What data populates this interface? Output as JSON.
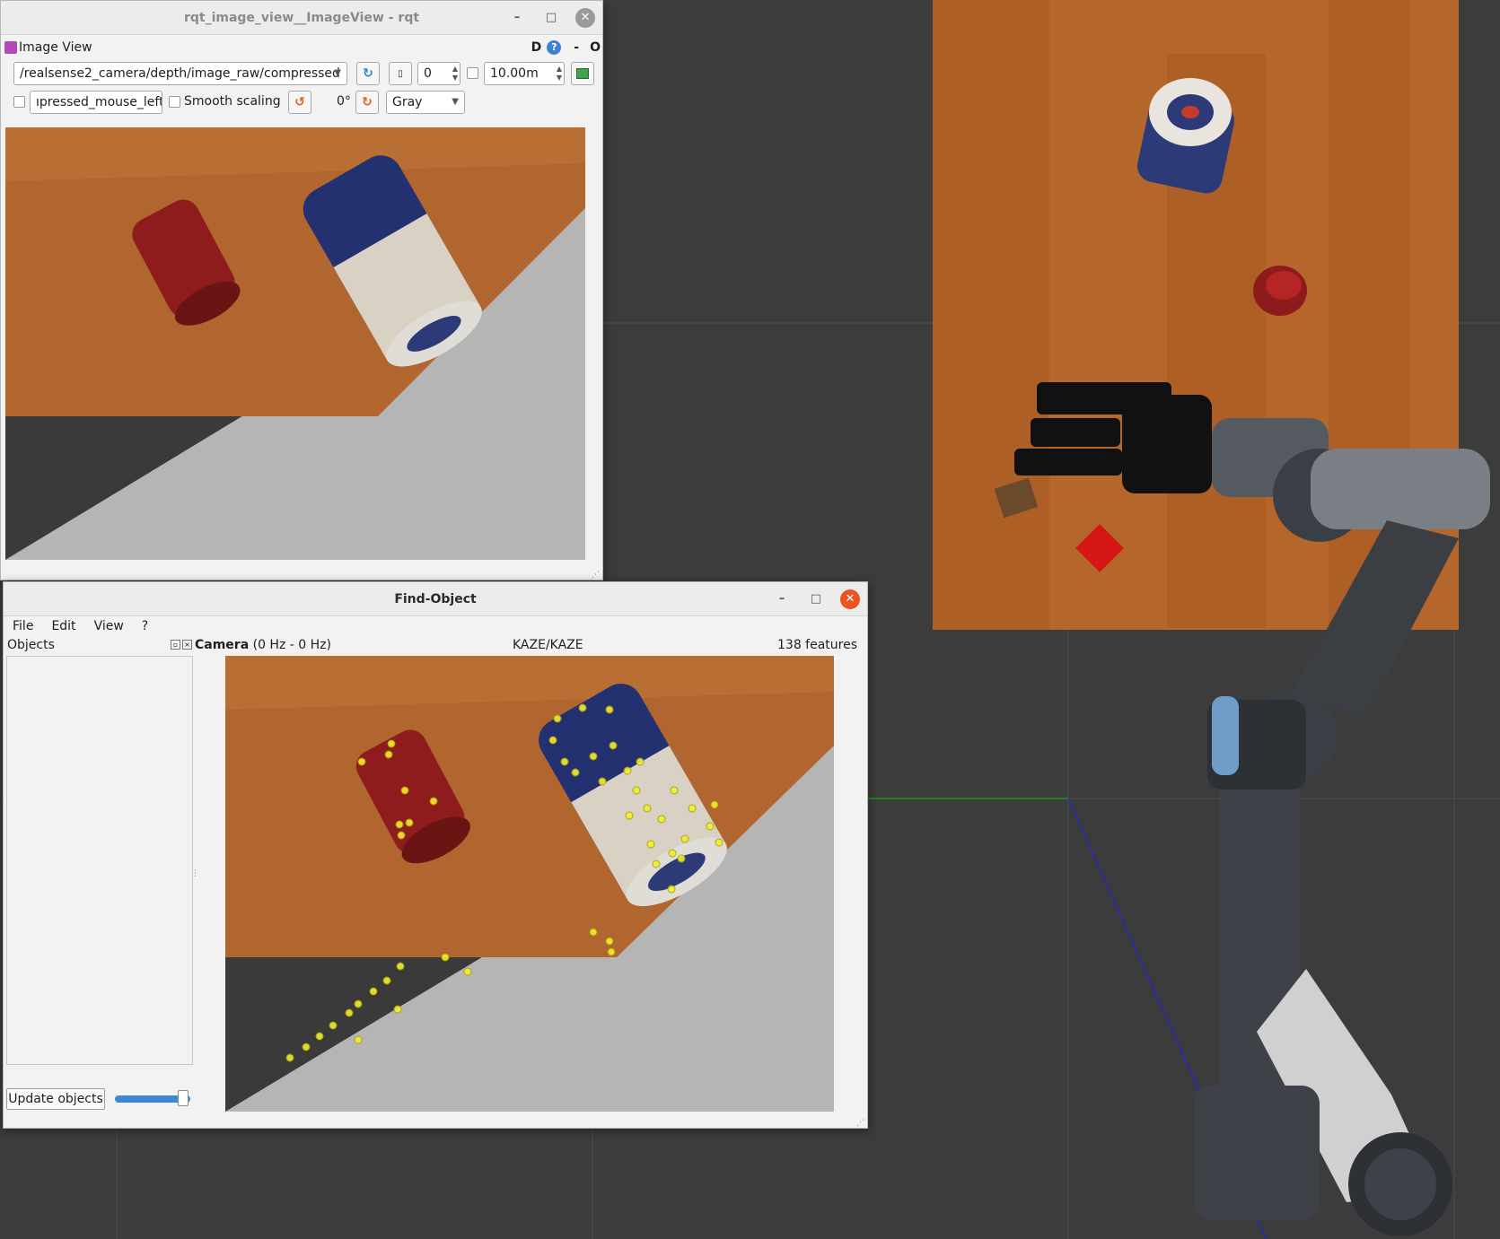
{
  "rqt_window": {
    "title": "rqt_image_view__ImageView - rqt",
    "minimize_icon": "minimize-icon",
    "maximize_icon": "maximize-icon",
    "close_icon": "close-icon",
    "dock_title": "Image View",
    "dock_help_label": "D",
    "dock_help_badge": "?",
    "dock_minus": "-",
    "dock_close": "O",
    "topic": "/realsense2_camera/depth/image_raw/compressed",
    "refresh_icon": "refresh-icon",
    "zoom_icon": "zoom-icon",
    "spin_value": "0",
    "max_range_value": "10.00m",
    "save_icon": "save-image-icon",
    "mouse_topic_value": "ıpressed_mouse_left",
    "smooth_scaling_label": "Smooth scaling",
    "rotate_left_icon": "rotate-left-icon",
    "rotation_value": "0°",
    "rotate_right_icon": "rotate-right-icon",
    "colormap_value": "Gray"
  },
  "find_object_window": {
    "title": "Find-Object",
    "menu": [
      "File",
      "Edit",
      "View",
      "?"
    ],
    "objects_panel_title": "Objects",
    "camera_label": "Camera",
    "camera_rate": "(0 Hz - 0 Hz)",
    "detector": "KAZE/KAZE",
    "features": "138 features",
    "update_button": "Update objects"
  }
}
